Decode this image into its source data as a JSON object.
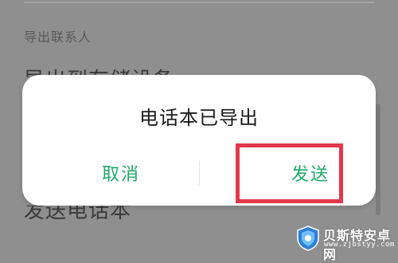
{
  "background": {
    "section_label": "导出联系人",
    "partial_row_top": "导出到存储设备",
    "partial_row_bottom": "发送电话本"
  },
  "dialog": {
    "title": "电话本已导出",
    "cancel_label": "取消",
    "send_label": "发送"
  },
  "colors": {
    "accent_green": "#1fa868",
    "highlight_red": "#e0384c",
    "scrim": "#8f8f8f"
  },
  "watermark": {
    "name": "贝斯特安卓网",
    "url": "www.zjbstyy.com"
  }
}
